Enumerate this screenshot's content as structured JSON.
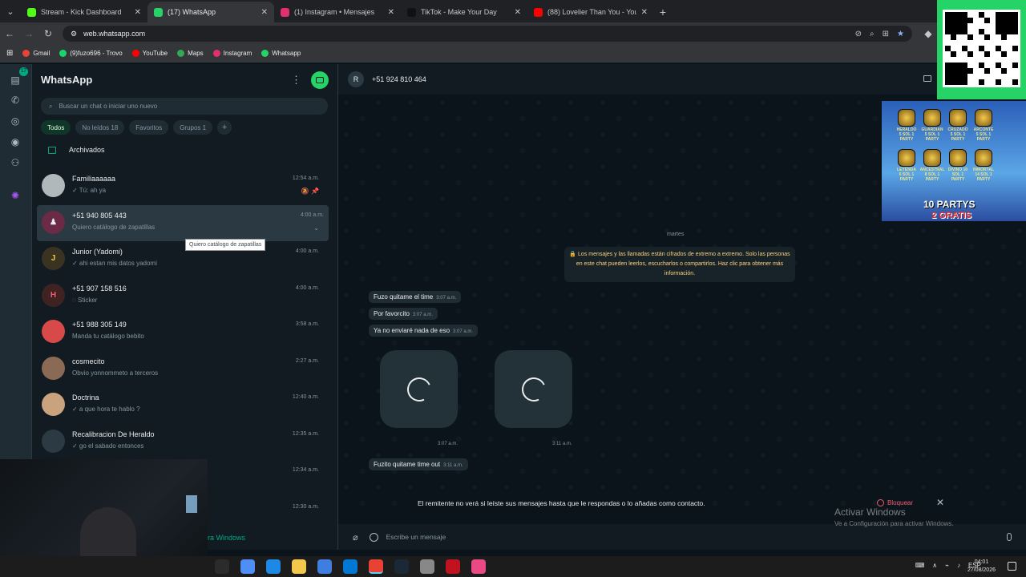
{
  "browser": {
    "tabs": [
      {
        "title": "Stream - Kick Dashboard",
        "color": "#53fc18",
        "active": false
      },
      {
        "title": "(17) WhatsApp",
        "color": "#25d366",
        "active": true
      },
      {
        "title": "(1) Instagram • Mensajes",
        "color": "#e1306c",
        "active": false
      },
      {
        "title": "TikTok - Make Your Day",
        "color": "#111111",
        "active": false
      },
      {
        "title": "(88) Lovelier Than You - YouTube",
        "color": "#ff0000",
        "active": false
      }
    ],
    "new_tab": "+",
    "url": "web.whatsapp.com",
    "bookmarks": [
      {
        "label": "Gmail",
        "color": "#ea4335"
      },
      {
        "label": "(9)fuzo696 - Trovo",
        "color": "#19d66b"
      },
      {
        "label": "YouTube",
        "color": "#ff0000"
      },
      {
        "label": "Maps",
        "color": "#34a853"
      },
      {
        "label": "Instagram",
        "color": "#e1306c"
      },
      {
        "label": "Whatsapp",
        "color": "#25d366"
      }
    ]
  },
  "rail": {
    "badge": "17"
  },
  "sidebar": {
    "title": "WhatsApp",
    "menu_icon": "⋮",
    "search_placeholder": "Buscar un chat o iniciar uno nuevo",
    "chips": [
      {
        "label": "Todos",
        "active": true
      },
      {
        "label": "No leídos 18",
        "active": false
      },
      {
        "label": "Favoritos",
        "active": false
      },
      {
        "label": "Grupos 1",
        "active": false
      }
    ],
    "chip_add": "+",
    "archived": "Archivados",
    "tooltip": "Quiero catálogo de zapatillas",
    "chats": [
      {
        "name": "Familiaaaaaa",
        "msg": "✓ Tú: ah ya",
        "time": "12:54 a.m.",
        "flags": "🔕 📌",
        "avatar": "",
        "avatar_color": "#b0b8bc"
      },
      {
        "name": "+51 940 805 443",
        "msg": "Quiero catálogo de zapatillas",
        "time": "4:00 a.m.",
        "flags": "⌄",
        "avatar": "♟",
        "avatar_color": "#6b2a45"
      },
      {
        "name": "Junior (Yadomi)",
        "msg": "✓ ahi estan mis datos yadomi",
        "time": "4:00 a.m.",
        "flags": "",
        "avatar": "J",
        "avatar_color": "#3a3322"
      },
      {
        "name": "+51 907 158 516",
        "msg": "◌ Sticker",
        "time": "4:00 a.m.",
        "flags": "",
        "avatar": "H",
        "avatar_color": "#3f2323"
      },
      {
        "name": "+51 988 305 149",
        "msg": "Manda tu catálogo bebito",
        "time": "3:58 a.m.",
        "flags": "",
        "avatar": "",
        "avatar_color": "#d84a4a"
      },
      {
        "name": "cosmecito",
        "msg": "Obvio yonnommeto a terceros",
        "time": "2:27 a.m.",
        "flags": "",
        "avatar": "",
        "avatar_color": "#8a6a55"
      },
      {
        "name": "Doctrina",
        "msg": "✓ a que hora te hablo ?",
        "time": "12:40 a.m.",
        "flags": "",
        "avatar": "",
        "avatar_color": "#c9a27e"
      },
      {
        "name": "Recalibracion De Heraldo",
        "msg": "✓ go el sabado entonces",
        "time": "12:35 a.m.",
        "flags": "",
        "avatar": "",
        "avatar_color": "#2c3a44"
      },
      {
        "name": "",
        "msg": "",
        "time": "12:34 a.m.",
        "flags": "",
        "avatar": "",
        "avatar_color": "#111b21"
      },
      {
        "name": "",
        "msg": "",
        "time": "12:30 a.m.",
        "flags": "",
        "avatar": "",
        "avatar_color": "#111b21"
      }
    ]
  },
  "conversation": {
    "avatar": "R",
    "name": "+51 924 810 464",
    "day": "martes",
    "encryption": "🔒 Los mensajes y las llamadas están cifrados de extremo a extremo. Solo las personas en este chat pueden leerlos, escucharlos o compartirlos. Haz clic para obtener más información.",
    "messages": [
      {
        "text": "Fuzo quitame el time",
        "time": "3:07 a.m."
      },
      {
        "text": "Por favorcito",
        "time": "3:07 a.m."
      },
      {
        "text": "Ya no enviaré nada de eso",
        "time": "3:07 a.m."
      }
    ],
    "media": [
      {
        "time": "3:07 a.m."
      },
      {
        "time": "3:11 a.m."
      }
    ],
    "last_message": {
      "text": "Fuzito quitame time out",
      "time": "3:11 a.m."
    },
    "notice": "El remitente no verá si leíste sus mensajes hasta que le respondas o lo añadas como contacto.",
    "block": "Bloquear",
    "close": "✕",
    "input_placeholder": "Escribe un mensaje"
  },
  "activate_windows": {
    "line1": "Activar Windows",
    "line2": "Ve a Configuración para activar Windows."
  },
  "promo": {
    "line1": "10 PARTYS",
    "line2": "2 GRATIS",
    "badges": [
      "HERALDO 5 SOL 1 PARTY",
      "GUARDIAN 5 SOL 1 PARTY",
      "CRUZADO 5 SOL 1 PARTY",
      "ARCONTE 5 SOL 1 PARTY",
      "",
      "LEYENDA 6 SOL 1 PARTY",
      "ANCESTRAL 8 SOL 1 PARTY",
      "DIVINO 10 SOL 1 PARTY",
      "INMORTAL 14 SOL 1 PARTY",
      ""
    ]
  },
  "cam_tail": "ra Windows",
  "taskbar": {
    "apps": [
      "#2b2b2b",
      "#4f8ef7",
      "#1e88e5",
      "#f2c94c",
      "#3f7de0",
      "#0078d4",
      "#e94235",
      "#1b2838",
      "#888888",
      "#c1121f",
      "#e94a85"
    ],
    "lang": "ESP",
    "time": "04:01",
    "date": "27/08/2026"
  }
}
